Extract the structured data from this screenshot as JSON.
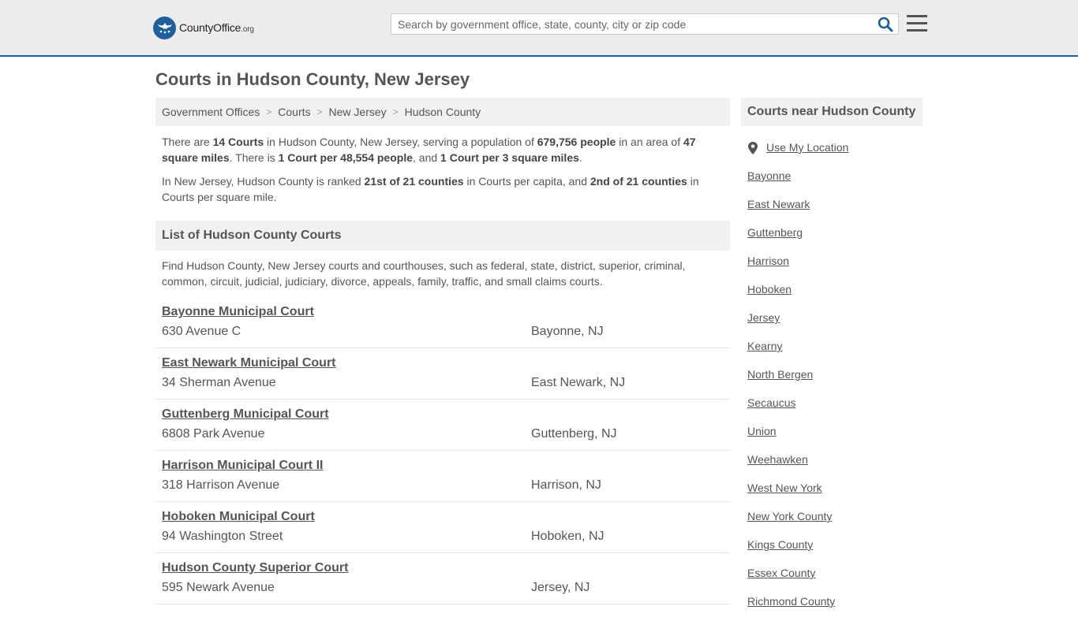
{
  "header": {
    "logo_main": "CountyOffice",
    "logo_suffix": ".org",
    "search_placeholder": "Search by government office, state, county, city or zip code"
  },
  "page_title": "Courts in Hudson County, New Jersey",
  "breadcrumb": [
    "Government Offices",
    "Courts",
    "New Jersey",
    "Hudson County"
  ],
  "summary": {
    "p1": [
      {
        "t": "There are ",
        "b": false
      },
      {
        "t": "14 Courts",
        "b": true
      },
      {
        "t": " in Hudson County, New Jersey, serving a population of ",
        "b": false
      },
      {
        "t": "679,756 people",
        "b": true
      },
      {
        "t": " in an area of ",
        "b": false
      },
      {
        "t": "47 square miles",
        "b": true
      },
      {
        "t": ". There is ",
        "b": false
      },
      {
        "t": "1 Court per 48,554 people",
        "b": true
      },
      {
        "t": ", and ",
        "b": false
      },
      {
        "t": "1 Court per 3 square miles",
        "b": true
      },
      {
        "t": ".",
        "b": false
      }
    ],
    "p2": [
      {
        "t": "In New Jersey, Hudson County is ranked ",
        "b": false
      },
      {
        "t": "21st of 21 counties",
        "b": true
      },
      {
        "t": " in Courts per capita, and ",
        "b": false
      },
      {
        "t": "2nd of 21 counties",
        "b": true
      },
      {
        "t": " in Courts per square mile.",
        "b": false
      }
    ]
  },
  "list_section": {
    "title": "List of Hudson County Courts",
    "description": "Find Hudson County, New Jersey courts and courthouses, such as federal, state, district, superior, criminal, common, circuit, judicial, judiciary, divorce, appeals, family, traffic, and small claims courts."
  },
  "courts": [
    {
      "name": "Bayonne Municipal Court",
      "address": "630 Avenue C",
      "city": "Bayonne, NJ"
    },
    {
      "name": "East Newark Municipal Court",
      "address": "34 Sherman Avenue",
      "city": "East Newark, NJ"
    },
    {
      "name": "Guttenberg Municipal Court",
      "address": "6808 Park Avenue",
      "city": "Guttenberg, NJ"
    },
    {
      "name": "Harrison Municipal Court II",
      "address": "318 Harrison Avenue",
      "city": "Harrison, NJ"
    },
    {
      "name": "Hoboken Municipal Court",
      "address": "94 Washington Street",
      "city": "Hoboken, NJ"
    },
    {
      "name": "Hudson County Superior Court",
      "address": "595 Newark Avenue",
      "city": "Jersey, NJ"
    }
  ],
  "sidebar": {
    "title": "Courts near Hudson County",
    "use_location": "Use My Location",
    "links": [
      "Bayonne",
      "East Newark",
      "Guttenberg",
      "Harrison",
      "Hoboken",
      "Jersey",
      "Kearny",
      "North Bergen",
      "Secaucus",
      "Union",
      "Weehawken",
      "West New York",
      "New York County",
      "Kings County",
      "Essex County",
      "Richmond County"
    ]
  }
}
